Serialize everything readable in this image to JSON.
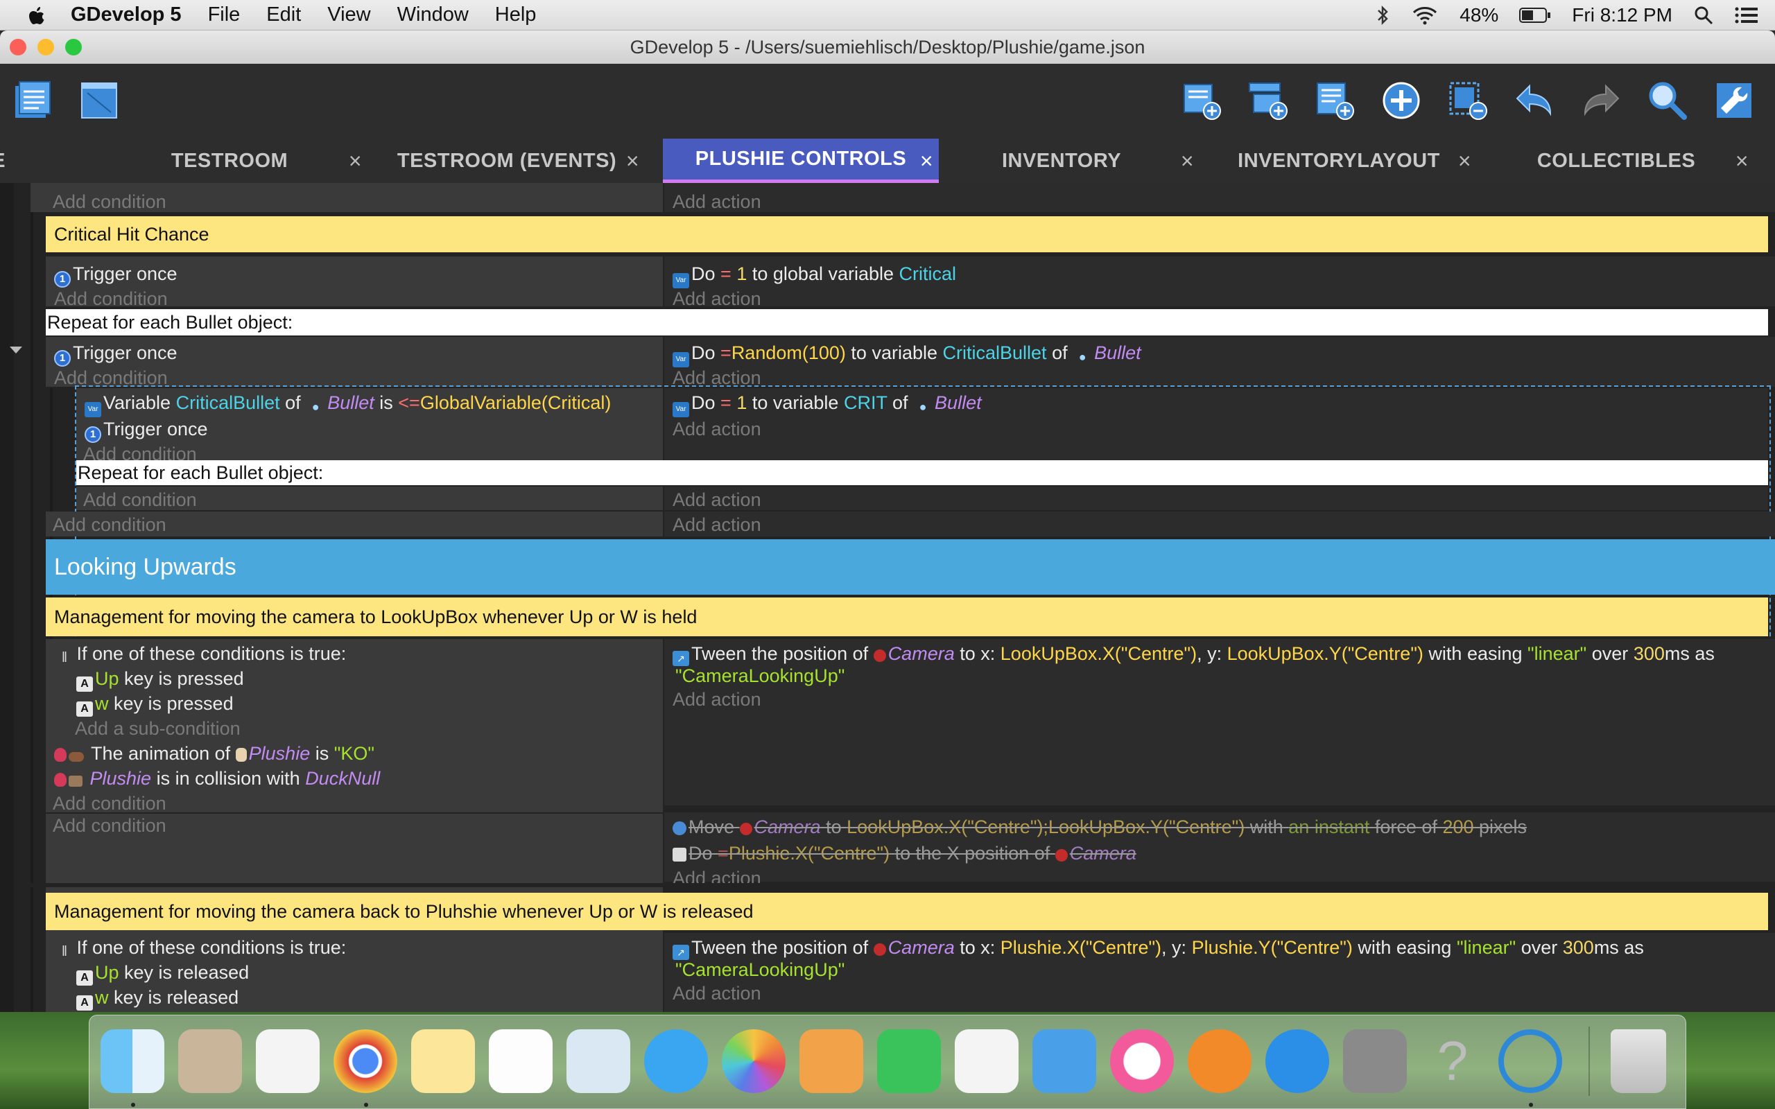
{
  "menubar": {
    "app_name": "GDevelop 5",
    "items": [
      "File",
      "Edit",
      "View",
      "Window",
      "Help"
    ],
    "battery": "48%",
    "clock": "Fri 8:12 PM"
  },
  "window": {
    "title": "GDevelop 5 - /Users/suemiehlisch/Desktop/Plushie/game.json"
  },
  "tabs": [
    {
      "label": "E",
      "active": false
    },
    {
      "label": "TESTROOM",
      "active": false
    },
    {
      "label": "TESTROOM (EVENTS)",
      "active": false
    },
    {
      "label": "PLUSHIE CONTROLS",
      "active": true
    },
    {
      "label": "INVENTORY",
      "active": false
    },
    {
      "label": "INVENTORYLAYOUT",
      "active": false
    },
    {
      "label": "COLLECTIBLES",
      "active": false
    }
  ],
  "tab_close": "×",
  "events": {
    "add_condition": "Add condition",
    "add_action": "Add action",
    "add_subcondition": "Add a sub-condition",
    "comment_critical": "Critical Hit Chance",
    "trigger_once": "Trigger once",
    "do": "Do",
    "one": "1",
    "to_global_variable": "to global variable",
    "critical": "Critical",
    "repeat_bullet": "Repeat for each Bullet object:",
    "random_expr": "Random(100)",
    "to_variable": "to variable",
    "critical_bullet": "CriticalBullet",
    "of": "of",
    "bullet": "Bullet",
    "variable": "Variable",
    "is": "is",
    "lte": "<=",
    "global_var_expr": "GlobalVariable(Critical)",
    "crit": "CRIT",
    "group_looking_upwards": "Looking Upwards",
    "comment_up": "Management for moving the camera to LookUpBox whenever Up or W is held",
    "or_header": "If one of these conditions is true:",
    "key_up": "Up",
    "key_w": "w",
    "key_is_pressed": "key is pressed",
    "key_is_released": "key is released",
    "animation_of": "The animation of",
    "plushie": "Plushie",
    "ko": "\"KO\"",
    "in_collision_with": "is in collision with",
    "ducknull": "DuckNull",
    "tween_position_of": "Tween the position of",
    "camera": "Camera",
    "to_x": "to x:",
    "lookupbox_x": "LookUpBox.X(\"Centre\")",
    "comma_y": ", y:",
    "lookupbox_y": "LookUpBox.Y(\"Centre\")",
    "with_easing": "with easing",
    "linear": "\"linear\"",
    "over": "over",
    "ms300": "300",
    "ms_as": "ms as",
    "camera_looking_up": "\"CameraLookingUp\"",
    "move": "Move",
    "to": "to",
    "lookupbox_xy": "LookUpBox.X(\"Centre\");LookUpBox.Y(\"Centre\")",
    "with": "with",
    "an_instant": "an instant",
    "force_of": "force of",
    "p200": "200",
    "pixels": "pixels",
    "plushie_x": "Plushie.X(\"Centre\")",
    "to_x_position_of": "to the X position of",
    "comment_release": "Management for moving the camera back to Pluhshie whenever Up or W is released",
    "plushie_y": "Plushie.Y(\"Centre\")",
    "eq": "="
  }
}
